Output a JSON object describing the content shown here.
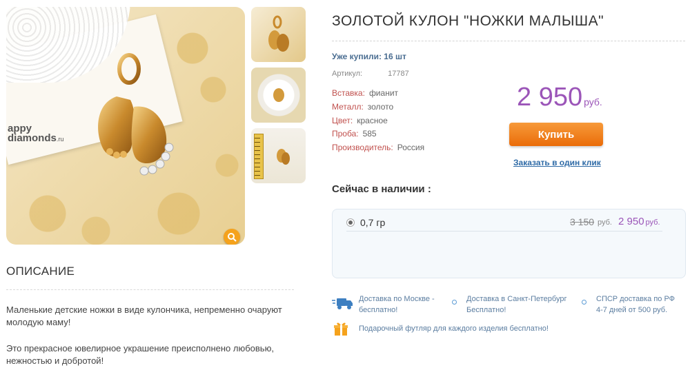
{
  "gallery": {
    "watermark_top": "appy",
    "watermark_bottom": "diamonds",
    "watermark_suffix": ".ru"
  },
  "description": {
    "title": "ОПИСАНИЕ",
    "p1": "Маленькие детские ножки в виде кулончика, непременно очаруют молодую маму!",
    "p2": "Это прекрасное ювелирное украшение преисполнено любовью, нежностью и добротой!"
  },
  "product": {
    "title": "ЗОЛОТОЙ КУЛОН \"НОЖКИ МАЛЫША\"",
    "bought": "Уже купили: 16 шт",
    "sku_label": "Артикул:",
    "sku_value": "17787",
    "props": [
      {
        "k": "Вставка:",
        "v": "фианит"
      },
      {
        "k": "Металл:",
        "v": "золото"
      },
      {
        "k": "Цвет:",
        "v": "красное"
      },
      {
        "k": "Проба:",
        "v": "585"
      },
      {
        "k": "Производитель:",
        "v": "Россия"
      }
    ],
    "price": "2 950",
    "currency": "руб.",
    "buy_label": "Купить",
    "oneclick_label": "Заказать в один клик"
  },
  "stock": {
    "title": "Сейчас в наличии :",
    "row": {
      "weight": "0,7 гр",
      "old_price": "3 150",
      "old_currency": "руб.",
      "new_price": "2 950",
      "new_currency": "руб."
    }
  },
  "delivery": [
    {
      "line1": "Доставка по Москве -",
      "line2": "бесплатно!"
    },
    {
      "line1": "Доставка в Санкт-Петербург",
      "line2": "Бесплатно!"
    },
    {
      "line1": "СПСР доставка по РФ",
      "line2": "4-7 дней от 500 руб."
    }
  ],
  "gift": "Подарочный футляр для каждого изделия бесплатно!",
  "colors": {
    "accent_purple": "#9b55b8",
    "button_orange": "#ea6c09",
    "link_blue": "#2e6aa6",
    "prop_label_red": "#c0504d"
  }
}
